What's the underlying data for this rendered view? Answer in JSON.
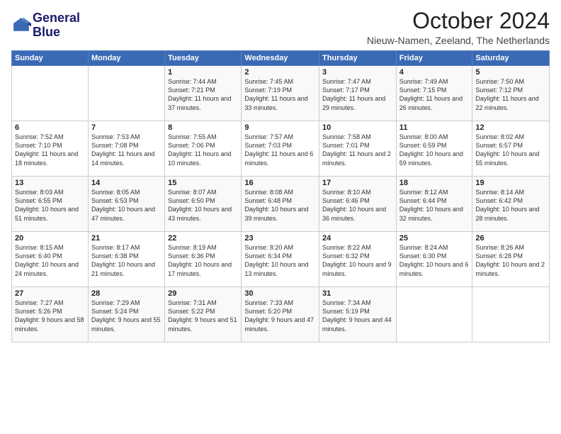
{
  "logo": {
    "line1": "General",
    "line2": "Blue"
  },
  "title": "October 2024",
  "subtitle": "Nieuw-Namen, Zeeland, The Netherlands",
  "weekdays": [
    "Sunday",
    "Monday",
    "Tuesday",
    "Wednesday",
    "Thursday",
    "Friday",
    "Saturday"
  ],
  "weeks": [
    [
      {
        "day": "",
        "info": ""
      },
      {
        "day": "",
        "info": ""
      },
      {
        "day": "1",
        "info": "Sunrise: 7:44 AM\nSunset: 7:21 PM\nDaylight: 11 hours and 37 minutes."
      },
      {
        "day": "2",
        "info": "Sunrise: 7:45 AM\nSunset: 7:19 PM\nDaylight: 11 hours and 33 minutes."
      },
      {
        "day": "3",
        "info": "Sunrise: 7:47 AM\nSunset: 7:17 PM\nDaylight: 11 hours and 29 minutes."
      },
      {
        "day": "4",
        "info": "Sunrise: 7:49 AM\nSunset: 7:15 PM\nDaylight: 11 hours and 26 minutes."
      },
      {
        "day": "5",
        "info": "Sunrise: 7:50 AM\nSunset: 7:12 PM\nDaylight: 11 hours and 22 minutes."
      }
    ],
    [
      {
        "day": "6",
        "info": "Sunrise: 7:52 AM\nSunset: 7:10 PM\nDaylight: 11 hours and 18 minutes."
      },
      {
        "day": "7",
        "info": "Sunrise: 7:53 AM\nSunset: 7:08 PM\nDaylight: 11 hours and 14 minutes."
      },
      {
        "day": "8",
        "info": "Sunrise: 7:55 AM\nSunset: 7:06 PM\nDaylight: 11 hours and 10 minutes."
      },
      {
        "day": "9",
        "info": "Sunrise: 7:57 AM\nSunset: 7:03 PM\nDaylight: 11 hours and 6 minutes."
      },
      {
        "day": "10",
        "info": "Sunrise: 7:58 AM\nSunset: 7:01 PM\nDaylight: 11 hours and 2 minutes."
      },
      {
        "day": "11",
        "info": "Sunrise: 8:00 AM\nSunset: 6:59 PM\nDaylight: 10 hours and 59 minutes."
      },
      {
        "day": "12",
        "info": "Sunrise: 8:02 AM\nSunset: 6:57 PM\nDaylight: 10 hours and 55 minutes."
      }
    ],
    [
      {
        "day": "13",
        "info": "Sunrise: 8:03 AM\nSunset: 6:55 PM\nDaylight: 10 hours and 51 minutes."
      },
      {
        "day": "14",
        "info": "Sunrise: 8:05 AM\nSunset: 6:53 PM\nDaylight: 10 hours and 47 minutes."
      },
      {
        "day": "15",
        "info": "Sunrise: 8:07 AM\nSunset: 6:50 PM\nDaylight: 10 hours and 43 minutes."
      },
      {
        "day": "16",
        "info": "Sunrise: 8:08 AM\nSunset: 6:48 PM\nDaylight: 10 hours and 39 minutes."
      },
      {
        "day": "17",
        "info": "Sunrise: 8:10 AM\nSunset: 6:46 PM\nDaylight: 10 hours and 36 minutes."
      },
      {
        "day": "18",
        "info": "Sunrise: 8:12 AM\nSunset: 6:44 PM\nDaylight: 10 hours and 32 minutes."
      },
      {
        "day": "19",
        "info": "Sunrise: 8:14 AM\nSunset: 6:42 PM\nDaylight: 10 hours and 28 minutes."
      }
    ],
    [
      {
        "day": "20",
        "info": "Sunrise: 8:15 AM\nSunset: 6:40 PM\nDaylight: 10 hours and 24 minutes."
      },
      {
        "day": "21",
        "info": "Sunrise: 8:17 AM\nSunset: 6:38 PM\nDaylight: 10 hours and 21 minutes."
      },
      {
        "day": "22",
        "info": "Sunrise: 8:19 AM\nSunset: 6:36 PM\nDaylight: 10 hours and 17 minutes."
      },
      {
        "day": "23",
        "info": "Sunrise: 8:20 AM\nSunset: 6:34 PM\nDaylight: 10 hours and 13 minutes."
      },
      {
        "day": "24",
        "info": "Sunrise: 8:22 AM\nSunset: 6:32 PM\nDaylight: 10 hours and 9 minutes."
      },
      {
        "day": "25",
        "info": "Sunrise: 8:24 AM\nSunset: 6:30 PM\nDaylight: 10 hours and 6 minutes."
      },
      {
        "day": "26",
        "info": "Sunrise: 8:26 AM\nSunset: 6:28 PM\nDaylight: 10 hours and 2 minutes."
      }
    ],
    [
      {
        "day": "27",
        "info": "Sunrise: 7:27 AM\nSunset: 5:26 PM\nDaylight: 9 hours and 58 minutes."
      },
      {
        "day": "28",
        "info": "Sunrise: 7:29 AM\nSunset: 5:24 PM\nDaylight: 9 hours and 55 minutes."
      },
      {
        "day": "29",
        "info": "Sunrise: 7:31 AM\nSunset: 5:22 PM\nDaylight: 9 hours and 51 minutes."
      },
      {
        "day": "30",
        "info": "Sunrise: 7:33 AM\nSunset: 5:20 PM\nDaylight: 9 hours and 47 minutes."
      },
      {
        "day": "31",
        "info": "Sunrise: 7:34 AM\nSunset: 5:19 PM\nDaylight: 9 hours and 44 minutes."
      },
      {
        "day": "",
        "info": ""
      },
      {
        "day": "",
        "info": ""
      }
    ]
  ],
  "colors": {
    "header_bg": "#3b6ab5",
    "header_text": "#ffffff",
    "border": "#cccccc",
    "title": "#222222",
    "subtitle": "#444444"
  }
}
